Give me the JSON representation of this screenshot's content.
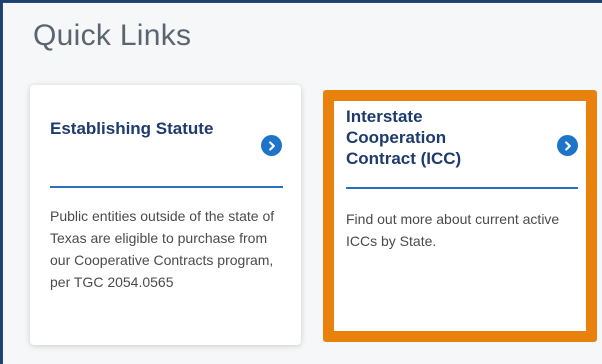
{
  "section": {
    "title": "Quick Links"
  },
  "cards": [
    {
      "title": "Establishing Statute",
      "description": "Public entities outside of the state of Texas are eligible to purchase from our Cooperative Contracts program, per TGC 2054.0565",
      "icon": "chevron-right-circle-icon",
      "highlighted": false
    },
    {
      "title": "Interstate Cooperation Contract (ICC)",
      "description": "Find out more about current active ICCs by State.",
      "icon": "chevron-right-circle-icon",
      "highlighted": true
    }
  ],
  "colors": {
    "accent_blue": "#1e74c9",
    "heading_navy": "#1d3b6e",
    "highlight_orange": "#e8820c"
  }
}
